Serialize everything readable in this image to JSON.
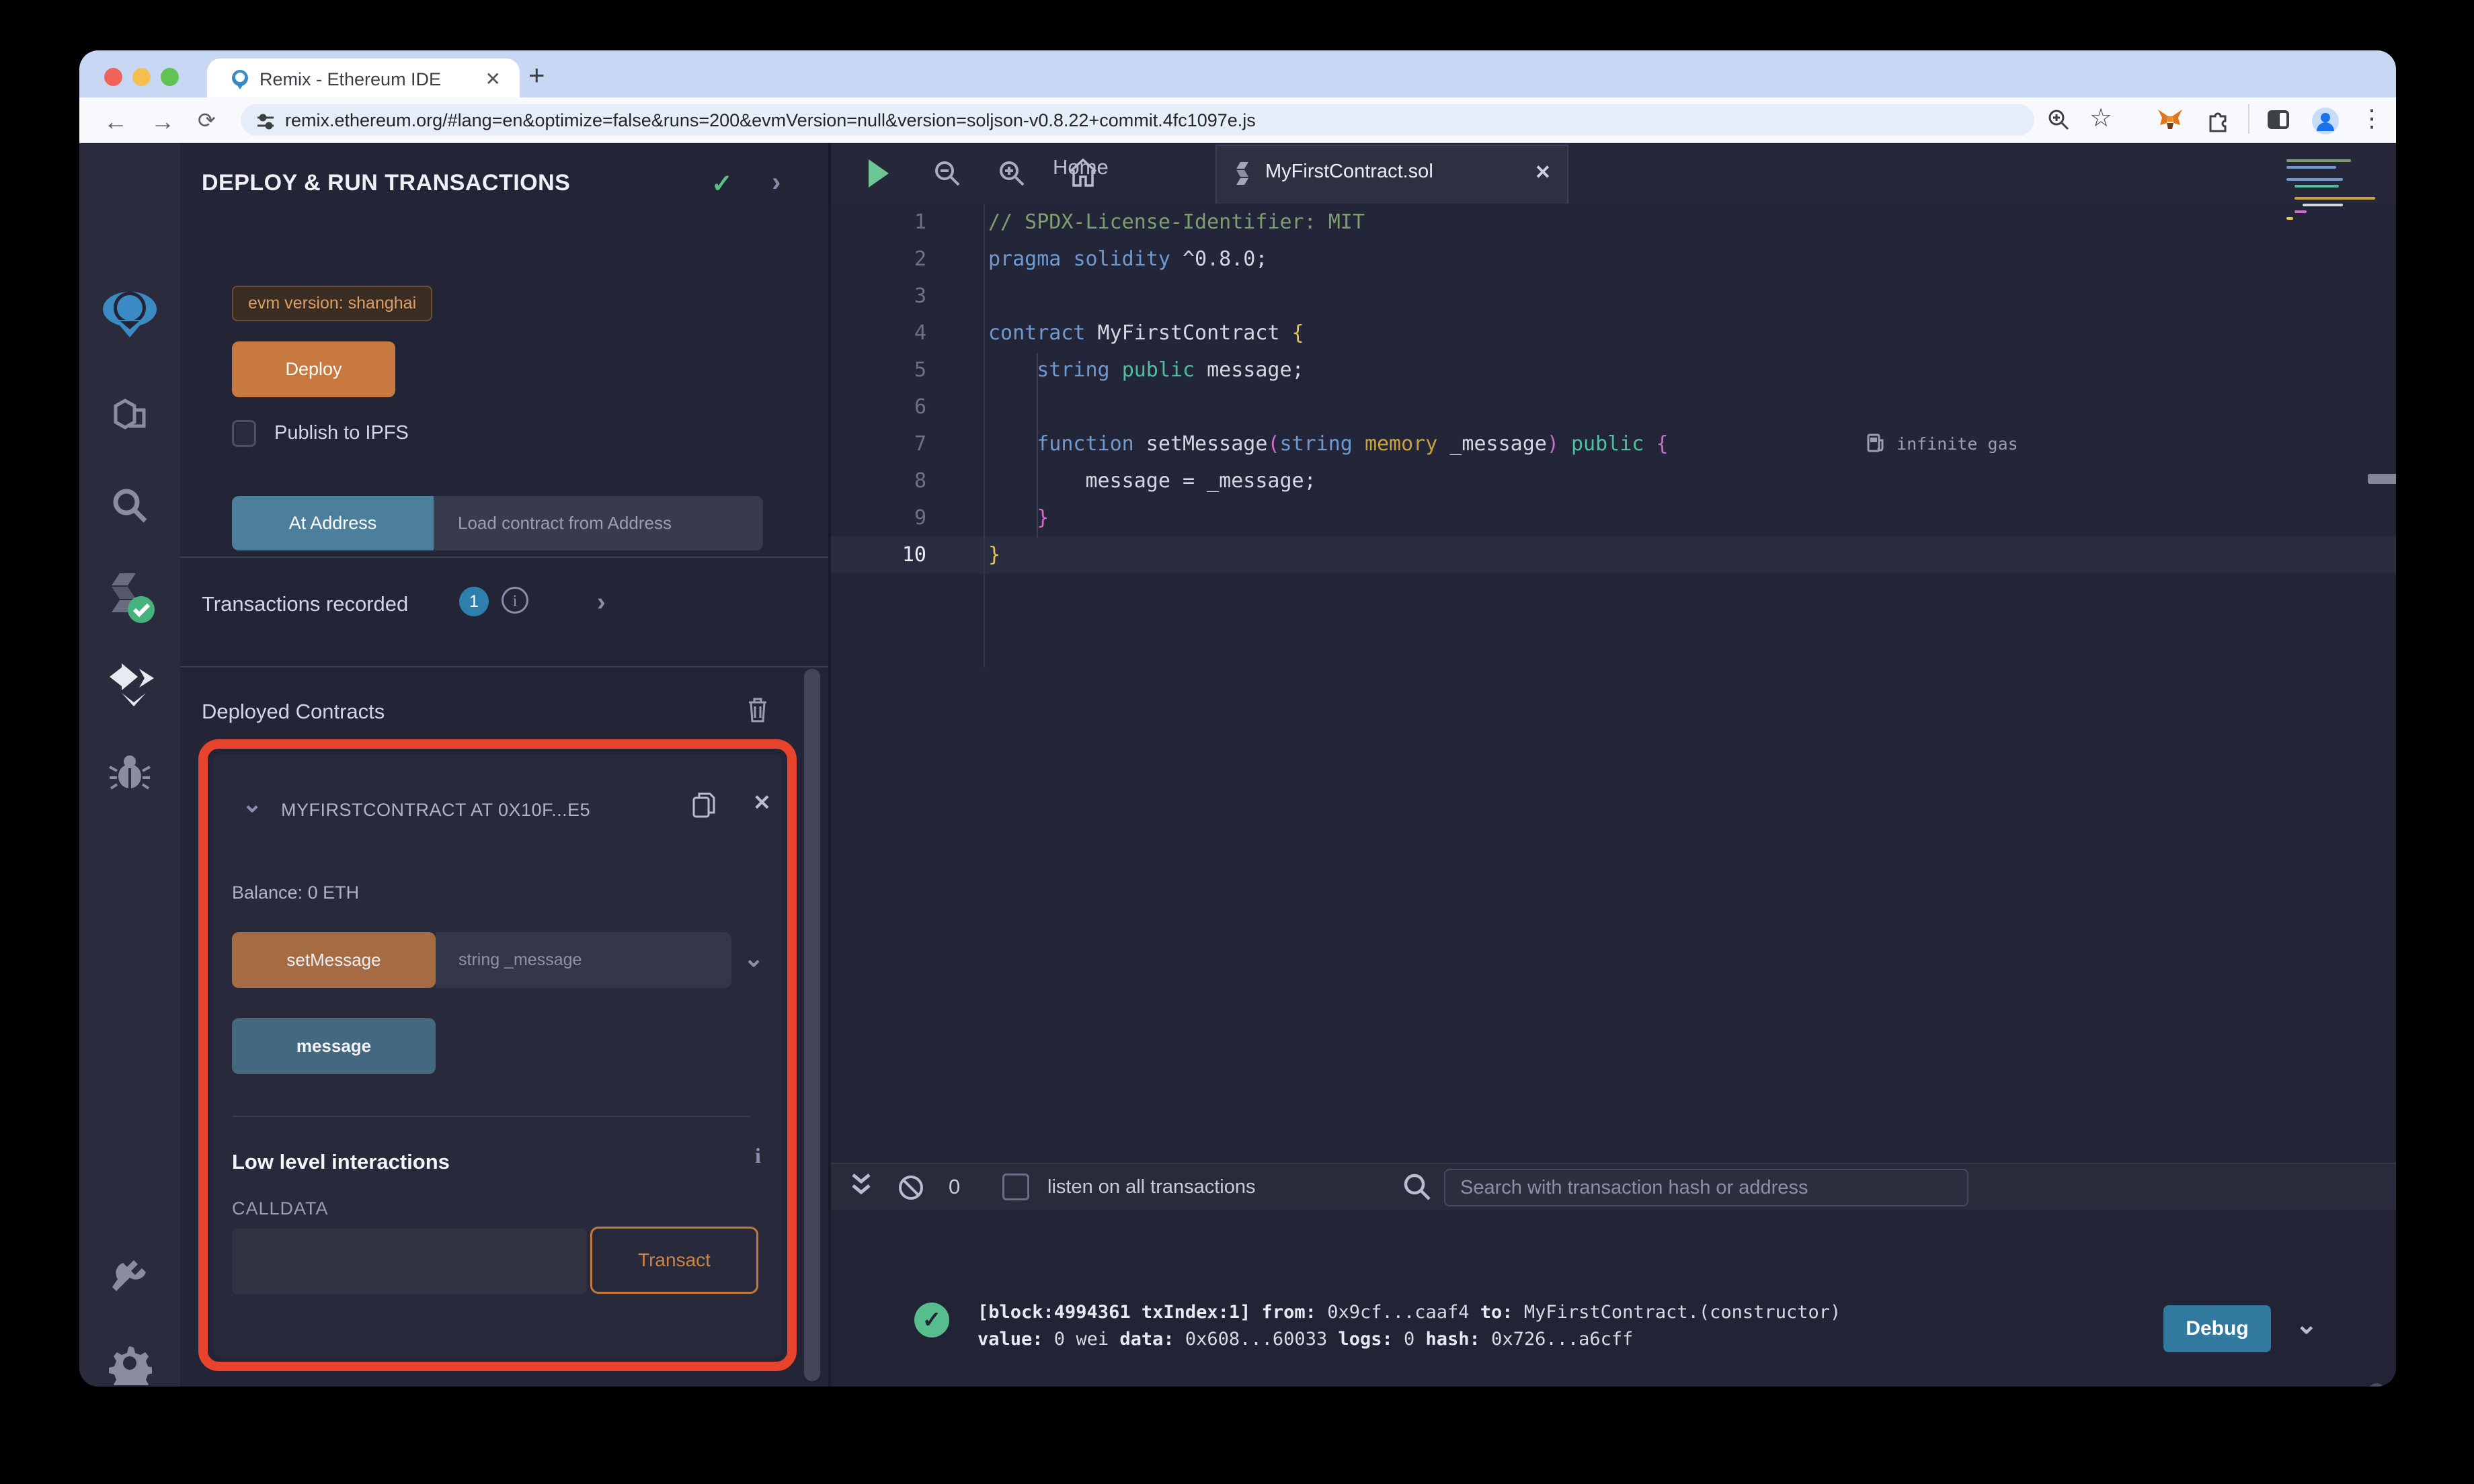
{
  "browser": {
    "tab_title": "Remix - Ethereum IDE",
    "new_tab_label": "+",
    "tab_close_label": "✕",
    "url": "remix.ethereum.org/#lang=en&optimize=false&runs=200&evmVersion=null&version=soljson-v0.8.22+commit.4fc1097e.js",
    "icons": [
      "back-arrow",
      "forward-arrow",
      "reload",
      "tune",
      "zoom",
      "bookmark-star",
      "metamask",
      "extensions",
      "sidebar-toggle",
      "profile-avatar",
      "menu-dots"
    ]
  },
  "rail_icons": [
    "remix-logo",
    "file-explorer",
    "search",
    "solidity-compiler",
    "deploy-and-run",
    "debugger",
    "plugin-manager",
    "settings"
  ],
  "panel": {
    "title": "DEPLOY & RUN TRANSACTIONS",
    "header_chevron": "›",
    "evm_badge": "evm version: shanghai",
    "deploy_label": "Deploy",
    "publish_label": "Publish to IPFS",
    "at_address_label": "At Address",
    "at_address_placeholder": "Load contract from Address",
    "transactions_recorded_label": "Transactions recorded",
    "transactions_count": "1",
    "info_glyph": "i",
    "section_chevron": "›",
    "deployed_contracts_label": "Deployed Contracts",
    "contract": {
      "collapse_chevron": "⌄",
      "title": "MYFIRSTCONTRACT AT 0X10F...E5",
      "close_glyph": "✕",
      "balance": "Balance: 0 ETH",
      "set_message_label": "setMessage",
      "set_message_placeholder": "string _message",
      "expand_chevron": "⌄",
      "message_label": "message",
      "low_level_label": "Low level interactions",
      "low_level_info_glyph": "i",
      "calldata_label": "CALLDATA",
      "transact_label": "Transact"
    }
  },
  "editor": {
    "home_tab_label": "Home",
    "file_tab_label": "MyFirstContract.sol",
    "file_tab_close": "✕",
    "gas_hint": "infinite gas",
    "code_lines": [
      {
        "n": "1",
        "tokens": [
          [
            "// SPDX-License-Identifier: MIT",
            "com"
          ]
        ]
      },
      {
        "n": "2",
        "tokens": [
          [
            "pragma",
            "kw"
          ],
          [
            " ",
            "pl"
          ],
          [
            "solidity",
            "kw"
          ],
          [
            " ^0.8.0;",
            "pl"
          ]
        ]
      },
      {
        "n": "3",
        "tokens": []
      },
      {
        "n": "4",
        "tokens": [
          [
            "contract",
            "kw"
          ],
          [
            " MyFirstContract ",
            "id"
          ],
          [
            "{",
            "brY"
          ]
        ]
      },
      {
        "n": "5",
        "tokens": [
          [
            "    ",
            "pl"
          ],
          [
            "string",
            "kw"
          ],
          [
            " ",
            "pl"
          ],
          [
            "public",
            "grn"
          ],
          [
            " message;",
            "id"
          ]
        ]
      },
      {
        "n": "6",
        "tokens": []
      },
      {
        "n": "7",
        "tokens": [
          [
            "    ",
            "pl"
          ],
          [
            "function",
            "kw"
          ],
          [
            " setMessage",
            "id"
          ],
          [
            "(",
            "pnk"
          ],
          [
            "string",
            "kw"
          ],
          [
            " ",
            "pl"
          ],
          [
            "memory",
            "gold"
          ],
          [
            " _message",
            "id"
          ],
          [
            ")",
            "pnk"
          ],
          [
            " ",
            "pl"
          ],
          [
            "public",
            "grn"
          ],
          [
            " ",
            "pl"
          ],
          [
            "{",
            "pnk"
          ]
        ]
      },
      {
        "n": "8",
        "tokens": [
          [
            "        message = _message;",
            "id"
          ]
        ]
      },
      {
        "n": "9",
        "tokens": [
          [
            "    ",
            "pl"
          ],
          [
            "}",
            "pnk"
          ]
        ]
      },
      {
        "n": "10",
        "current": true,
        "tokens": [
          [
            "}",
            "brY"
          ]
        ]
      }
    ]
  },
  "terminal": {
    "badge_count": "0",
    "listen_label": "listen on all transactions",
    "search_placeholder": "Search with transaction hash or address",
    "log_check_glyph": "✓",
    "log_lines": [
      [
        [
          "[block:4994361 txIndex:1]",
          1
        ],
        [
          " ",
          0
        ],
        [
          "from:",
          1
        ],
        [
          " 0x9cf...caaf4 ",
          0
        ],
        [
          "to:",
          1
        ],
        [
          " MyFirstContract.(constructor)",
          0
        ]
      ],
      [
        [
          "value:",
          1
        ],
        [
          " 0 wei ",
          0
        ],
        [
          "data:",
          1
        ],
        [
          " 0x608...60033 ",
          0
        ],
        [
          "logs:",
          1
        ],
        [
          " 0 ",
          0
        ],
        [
          "hash:",
          1
        ],
        [
          " 0x726...a6cff",
          0
        ]
      ]
    ],
    "debug_label": "Debug",
    "prompt": ">"
  },
  "colors": {
    "highlight_box": "#e8432c",
    "deploy_orange": "#c8793f",
    "at_address_teal": "#4c7f9b",
    "message_slate": "#44687f",
    "debug_blue": "#31799f",
    "success_green": "#57bd8e",
    "badge_blue": "#2f7fae",
    "evm_badge_text": "#dd9c62"
  }
}
